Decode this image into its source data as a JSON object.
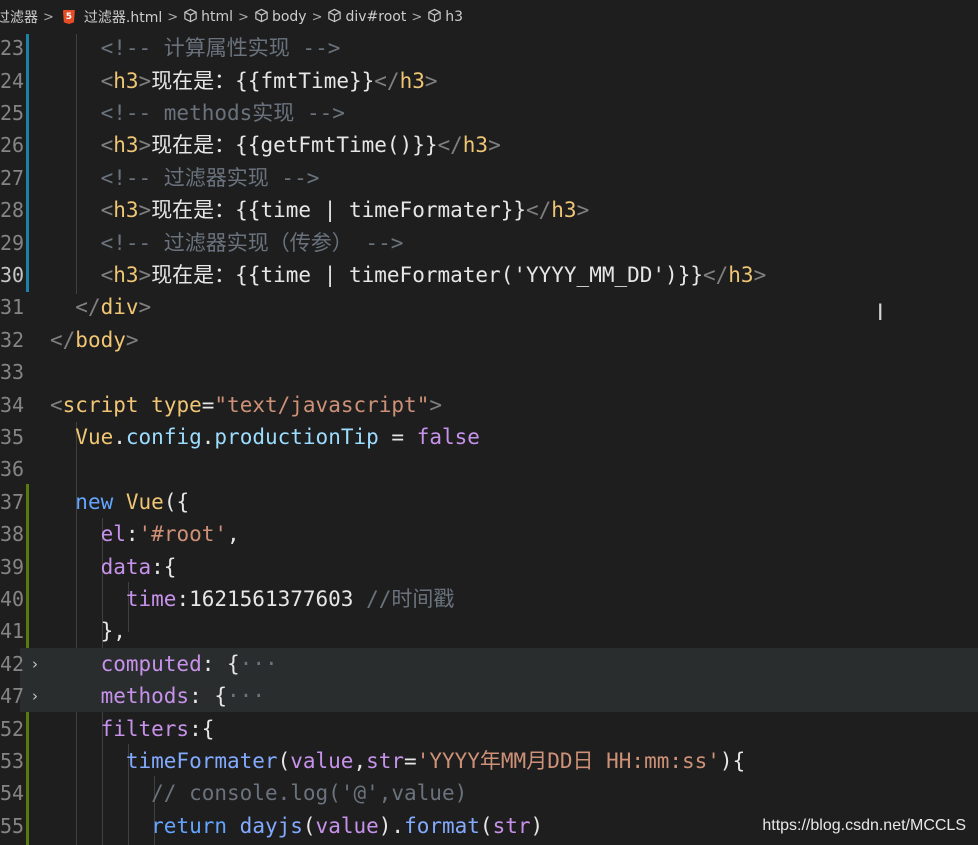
{
  "breadcrumb": [
    {
      "label": "过滤器",
      "icon": "none"
    },
    {
      "label": "过滤器.html",
      "icon": "html5-icon"
    },
    {
      "label": "html",
      "icon": "cube-icon"
    },
    {
      "label": "body",
      "icon": "cube-icon"
    },
    {
      "label": "div#root",
      "icon": "cube-icon"
    },
    {
      "label": "h3",
      "icon": "cube-icon"
    }
  ],
  "breadcrumb_separator": ">",
  "fold_marker": "›",
  "watermark": "https://blog.csdn.net/MCCLS",
  "active_line": "30",
  "lines": [
    {
      "num": "23",
      "tokens": [
        [
          "ws",
          "    "
        ],
        [
          "comment",
          "<!-- 计算属性实现 -->"
        ]
      ]
    },
    {
      "num": "24",
      "tokens": [
        [
          "ws",
          "    "
        ],
        [
          "punct",
          "<"
        ],
        [
          "tag",
          "h3"
        ],
        [
          "punct",
          ">"
        ],
        [
          "text",
          "现在是：{{fmtTime}}"
        ],
        [
          "punct",
          "</"
        ],
        [
          "tag",
          "h3"
        ],
        [
          "punct",
          ">"
        ]
      ]
    },
    {
      "num": "25",
      "tokens": [
        [
          "ws",
          "    "
        ],
        [
          "comment",
          "<!-- methods实现 -->"
        ]
      ]
    },
    {
      "num": "26",
      "tokens": [
        [
          "ws",
          "    "
        ],
        [
          "punct",
          "<"
        ],
        [
          "tag",
          "h3"
        ],
        [
          "punct",
          ">"
        ],
        [
          "text",
          "现在是：{{getFmtTime()}}"
        ],
        [
          "punct",
          "</"
        ],
        [
          "tag",
          "h3"
        ],
        [
          "punct",
          ">"
        ]
      ]
    },
    {
      "num": "27",
      "tokens": [
        [
          "ws",
          "    "
        ],
        [
          "comment",
          "<!-- 过滤器实现 -->"
        ]
      ]
    },
    {
      "num": "28",
      "tokens": [
        [
          "ws",
          "    "
        ],
        [
          "punct",
          "<"
        ],
        [
          "tag",
          "h3"
        ],
        [
          "punct",
          ">"
        ],
        [
          "text",
          "现在是：{{time | timeFormater}}"
        ],
        [
          "punct",
          "</"
        ],
        [
          "tag",
          "h3"
        ],
        [
          "punct",
          ">"
        ]
      ]
    },
    {
      "num": "29",
      "tokens": [
        [
          "ws",
          "    "
        ],
        [
          "comment",
          "<!-- 过滤器实现（传参） -->"
        ]
      ]
    },
    {
      "num": "30",
      "tokens": [
        [
          "ws",
          "    "
        ],
        [
          "punct",
          "<"
        ],
        [
          "tag",
          "h3"
        ],
        [
          "punct",
          ">"
        ],
        [
          "text",
          "现在是：{{time | timeFormater('YYYY_MM_DD')}}"
        ],
        [
          "punct",
          "</"
        ],
        [
          "tag",
          "h3"
        ],
        [
          "punct",
          ">"
        ]
      ]
    },
    {
      "num": "31",
      "tokens": [
        [
          "ws",
          "  "
        ],
        [
          "punct",
          "</"
        ],
        [
          "tag",
          "div"
        ],
        [
          "punct",
          ">"
        ]
      ]
    },
    {
      "num": "32",
      "tokens": [
        [
          "punct",
          "</"
        ],
        [
          "tag",
          "body"
        ],
        [
          "punct",
          ">"
        ]
      ]
    },
    {
      "num": "33",
      "tokens": []
    },
    {
      "num": "34",
      "tokens": [
        [
          "punct",
          "<"
        ],
        [
          "tag",
          "script"
        ],
        [
          "ws",
          " "
        ],
        [
          "tag",
          "type"
        ],
        [
          "text",
          "="
        ],
        [
          "string",
          "\"text/javascript\""
        ],
        [
          "punct",
          ">"
        ]
      ]
    },
    {
      "num": "35",
      "tokens": [
        [
          "ws",
          "  "
        ],
        [
          "tag",
          "Vue"
        ],
        [
          "text",
          "."
        ],
        [
          "attr",
          "config"
        ],
        [
          "text",
          "."
        ],
        [
          "attr",
          "productionTip"
        ],
        [
          "text",
          " = "
        ],
        [
          "prop",
          "false"
        ]
      ]
    },
    {
      "num": "36",
      "tokens": []
    },
    {
      "num": "37",
      "tokens": [
        [
          "ws",
          "  "
        ],
        [
          "keyword",
          "new"
        ],
        [
          "ws",
          " "
        ],
        [
          "tag",
          "Vue"
        ],
        [
          "text",
          "({"
        ]
      ]
    },
    {
      "num": "38",
      "tokens": [
        [
          "ws",
          "    "
        ],
        [
          "prop",
          "el"
        ],
        [
          "text",
          ":"
        ],
        [
          "string",
          "'#root'"
        ],
        [
          "text",
          ","
        ]
      ]
    },
    {
      "num": "39",
      "tokens": [
        [
          "ws",
          "    "
        ],
        [
          "prop",
          "data"
        ],
        [
          "text",
          ":{"
        ]
      ]
    },
    {
      "num": "40",
      "tokens": [
        [
          "ws",
          "      "
        ],
        [
          "prop",
          "time"
        ],
        [
          "text",
          ":1621561377603 "
        ],
        [
          "comment",
          "//时间戳"
        ]
      ]
    },
    {
      "num": "41",
      "tokens": [
        [
          "ws",
          "    "
        ],
        [
          "text",
          "},"
        ]
      ]
    },
    {
      "num": "42",
      "tokens": [
        [
          "ws",
          "    "
        ],
        [
          "prop",
          "computed"
        ],
        [
          "text",
          ": {"
        ],
        [
          "comment",
          "···"
        ]
      ],
      "folded": true
    },
    {
      "num": "47",
      "tokens": [
        [
          "ws",
          "    "
        ],
        [
          "prop",
          "methods"
        ],
        [
          "text",
          ": {"
        ],
        [
          "comment",
          "···"
        ]
      ],
      "folded": true
    },
    {
      "num": "52",
      "tokens": [
        [
          "ws",
          "    "
        ],
        [
          "prop",
          "filters"
        ],
        [
          "text",
          ":{"
        ]
      ]
    },
    {
      "num": "53",
      "tokens": [
        [
          "ws",
          "      "
        ],
        [
          "func",
          "timeFormater"
        ],
        [
          "text",
          "("
        ],
        [
          "prop",
          "value"
        ],
        [
          "text",
          ","
        ],
        [
          "prop",
          "str"
        ],
        [
          "text",
          "="
        ],
        [
          "string",
          "'YYYY年MM月DD日 HH:mm:ss'"
        ],
        [
          "text",
          "){"
        ]
      ]
    },
    {
      "num": "54",
      "tokens": [
        [
          "ws",
          "        "
        ],
        [
          "comment",
          "// console.log('@',value)"
        ]
      ]
    },
    {
      "num": "55",
      "tokens": [
        [
          "ws",
          "        "
        ],
        [
          "keyword",
          "return"
        ],
        [
          "ws",
          " "
        ],
        [
          "func",
          "dayjs"
        ],
        [
          "text",
          "("
        ],
        [
          "prop",
          "value"
        ],
        [
          "text",
          ")."
        ],
        [
          "func",
          "format"
        ],
        [
          "text",
          "("
        ],
        [
          "prop",
          "str"
        ],
        [
          "text",
          ")"
        ]
      ]
    }
  ]
}
